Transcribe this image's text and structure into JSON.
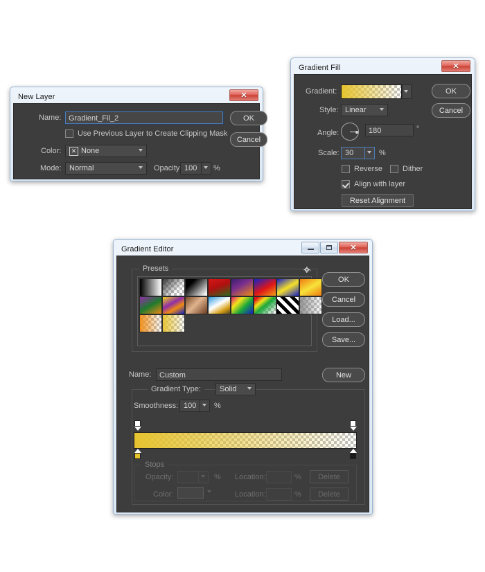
{
  "new_layer": {
    "title": "New Layer",
    "close_label": "✕",
    "name_label": "Name:",
    "name_value": "Gradient_Fil_2",
    "clipping_checkbox_label": "Use Previous Layer to Create Clipping Mask",
    "clipping_checked": false,
    "color_label": "Color:",
    "color_value": "None",
    "color_swatch_glyph": "✕",
    "mode_label": "Mode:",
    "mode_value": "Normal",
    "opacity_label": "Opacity:",
    "opacity_value": "100",
    "percent": "%",
    "ok_label": "OK",
    "cancel_label": "Cancel"
  },
  "gradient_fill": {
    "title": "Gradient Fill",
    "close_label": "✕",
    "gradient_label": "Gradient:",
    "style_label": "Style:",
    "style_value": "Linear",
    "angle_label": "Angle:",
    "angle_value": "180",
    "degree_symbol": "°",
    "scale_label": "Scale:",
    "scale_value": "30",
    "percent": "%",
    "reverse_label": "Reverse",
    "reverse_checked": false,
    "dither_label": "Dither",
    "dither_checked": false,
    "align_label": "Align with layer",
    "align_checked": true,
    "reset_alignment_label": "Reset Alignment",
    "ok_label": "OK",
    "cancel_label": "Cancel",
    "gradient_start_color": "#e6c32e",
    "gradient_end_color": "#ffffff"
  },
  "gradient_editor": {
    "title": "Gradient Editor",
    "minimize_label": "—",
    "maximize_label": "▫",
    "close_label": "✕",
    "presets_label": "Presets",
    "gear_icon_name": "gear-icon",
    "presets": [
      {
        "name": "foreground-to-background",
        "css": "linear-gradient(90deg,#000000 0%, #ffffff 100%)"
      },
      {
        "name": "foreground-to-transparent",
        "css": "linear-gradient(135deg,#3a3a3a 0%, rgba(60,60,60,0) 70%)",
        "checker": true
      },
      {
        "name": "black-white",
        "css": "linear-gradient(135deg,#000000 25%, #ffffff 95%)"
      },
      {
        "name": "red-green",
        "css": "linear-gradient(160deg,#d81616 0%, #b01010 45%, #2f6b1f 100%)"
      },
      {
        "name": "violet-orange",
        "css": "linear-gradient(150deg,#3b1f6e 0%, #7a2e8e 40%, #ef8a12 100%)"
      },
      {
        "name": "blue-red-yellow",
        "css": "linear-gradient(150deg,#1622c8 0%, #e01616 55%, #f0a215 100%)"
      },
      {
        "name": "blue-yellow-blue",
        "css": "linear-gradient(150deg,#1622c8 0%, #f5e02a 50%, #1622c8 100%)"
      },
      {
        "name": "orange-yellow-orange",
        "css": "linear-gradient(150deg,#ef7c10 0%, #f7e23a 50%, #ef7c10 100%)"
      },
      {
        "name": "violet-green-orange",
        "css": "linear-gradient(150deg,#8f2ea8 0%, #1f7a2e 50%, #ef8a12 100%)"
      },
      {
        "name": "yellow-violet-orange-blue",
        "css": "linear-gradient(150deg,#f2d21a 0%, #8f2ea8 40%, #ef8a12 65%, #1622c8 100%)"
      },
      {
        "name": "copper",
        "css": "linear-gradient(135deg,#7a4a28 0%, #e0b48e 45%, #6b3b20 100%)"
      },
      {
        "name": "chrome",
        "css": "linear-gradient(150deg,#2f9be0 0%, #ffffff 45%, #d8a018 75%, #5a4a20 100%)"
      },
      {
        "name": "spectrum",
        "css": "linear-gradient(135deg,#e01670 0%, #f2e41a 30%, #1ba83a 60%, #1622c8 100%)"
      },
      {
        "name": "transparent-rainbow",
        "css": "linear-gradient(140deg,#e01616 10%, #f2e41a 30%, #1ba83a 50%, rgba(22,34,200,0) 95%)",
        "checker": true
      },
      {
        "name": "transparent-stripes",
        "css": "repeating-linear-gradient(45deg,#000000 0 5px,#ffffff 5px 10px)"
      },
      {
        "name": "neutral-density",
        "css": "linear-gradient(90deg,rgba(130,130,130,0.85) 0%, rgba(130,130,130,0) 100%)",
        "checker": true
      },
      {
        "name": "foreground-to-transparent-orange",
        "css": "linear-gradient(90deg,rgba(240,140,20,0.95) 0%, rgba(240,140,20,0) 100%)",
        "checker": true
      },
      {
        "name": "gold-to-transparent",
        "css": "linear-gradient(90deg,rgba(230,195,46,0.95) 0%, rgba(230,195,46,0) 100%)",
        "checker": true
      }
    ],
    "name_label": "Name:",
    "name_value": "Custom",
    "gradient_type_label": "Gradient Type:",
    "gradient_type_value": "Solid",
    "smoothness_label": "Smoothness:",
    "smoothness_value": "100",
    "percent": "%",
    "stops_label": "Stops",
    "opacity_label": "Opacity:",
    "opacity_value": "",
    "color_label": "Color:",
    "location_label": "Location:",
    "location_value": "",
    "delete_label": "Delete",
    "ok_label": "OK",
    "cancel_label": "Cancel",
    "load_label": "Load...",
    "save_label": "Save...",
    "new_label": "New",
    "bar_start_color": "#e6c32e",
    "bar_end_color": "#ffffff"
  }
}
